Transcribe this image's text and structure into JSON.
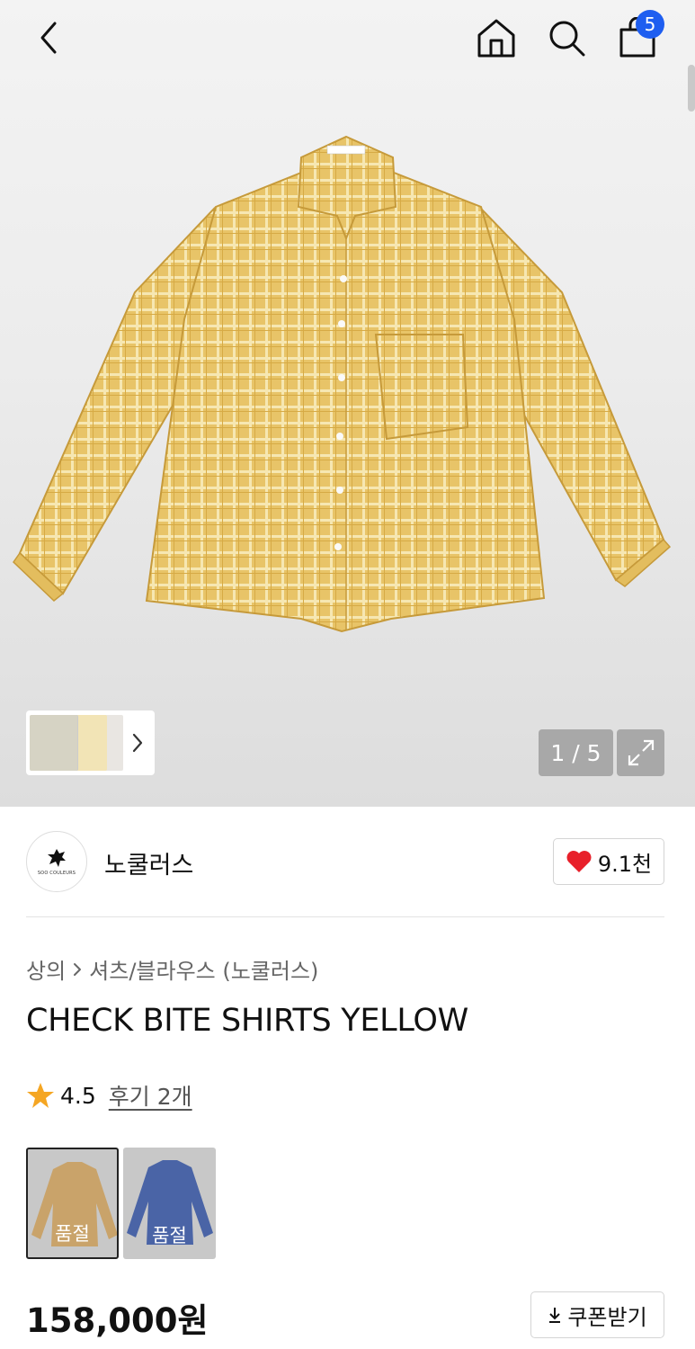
{
  "header": {
    "cart_count": "5",
    "icons": [
      "chevron-left-icon",
      "home-icon",
      "search-icon",
      "shopping-bag-icon"
    ]
  },
  "gallery": {
    "counter": "1 / 5",
    "current_image": 1,
    "total_images": 5,
    "product_color": "#e8c468"
  },
  "brand": {
    "name": "노쿨러스",
    "logo_text": "SOO COULEURS",
    "likes": "9.1천"
  },
  "breadcrumb": {
    "category": "상의",
    "subcategory": "셔츠/블라우스 (노쿨러스)"
  },
  "product": {
    "title": "CHECK BITE SHIRTS YELLOW",
    "rating": "4.5",
    "reviews": "후기 2개",
    "price": "158,000원",
    "coupon_label": "쿠폰받기"
  },
  "variants": [
    {
      "color": "#c9a36a",
      "status": "품절"
    },
    {
      "color": "#4a64a6",
      "status": "품절"
    }
  ],
  "colors": {
    "accent_badge": "#1e5ef0",
    "heart": "#e8202a",
    "star": "#f5a623"
  }
}
